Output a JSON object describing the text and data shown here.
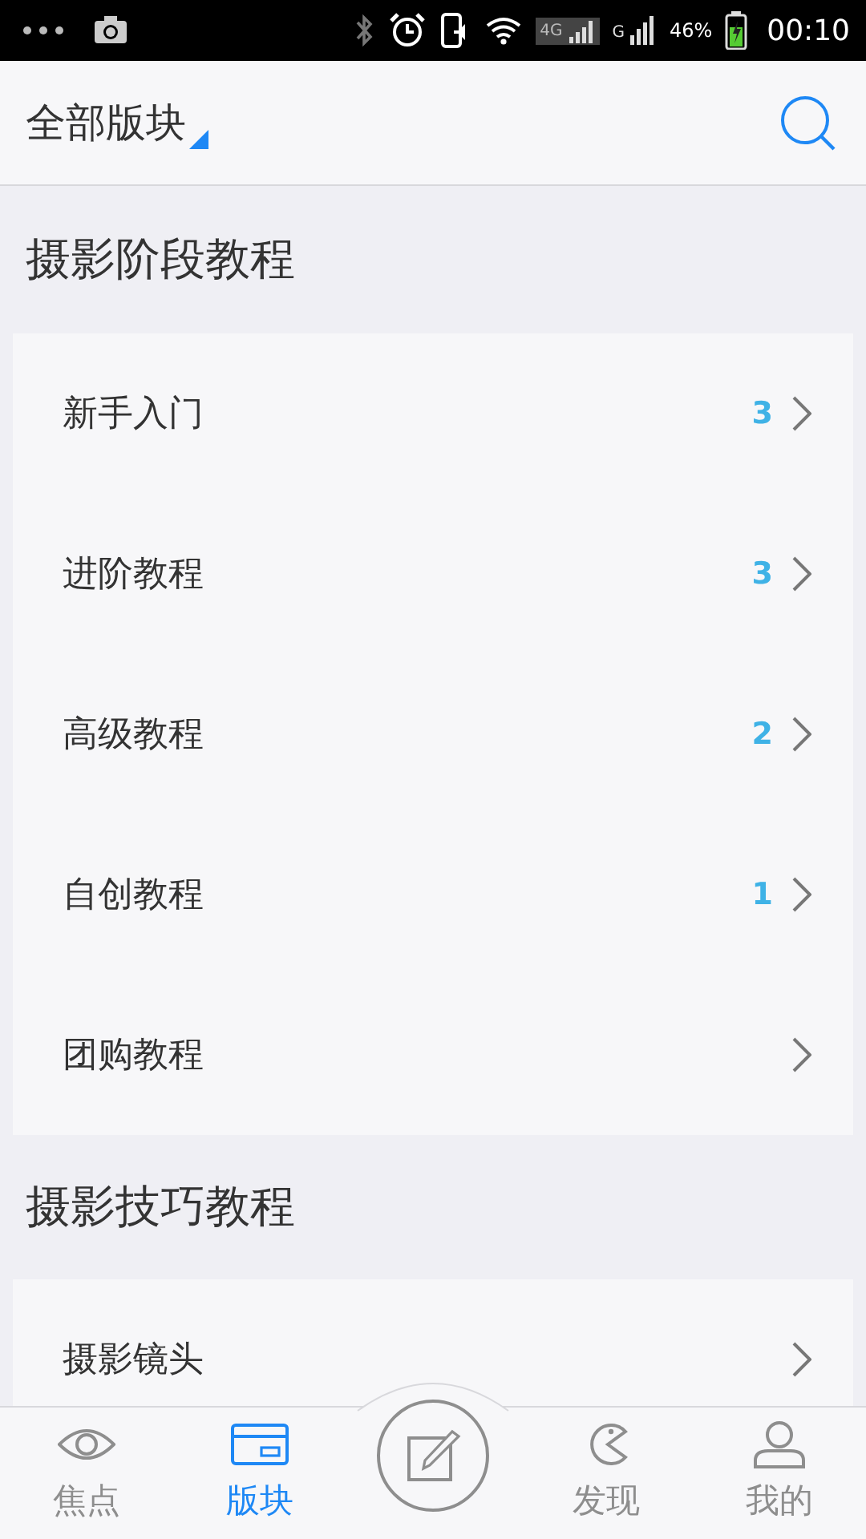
{
  "status_bar": {
    "network_1": "4G",
    "network_2": "G",
    "battery": "46%",
    "time": "00:10"
  },
  "header": {
    "title": "全部版块"
  },
  "sections": [
    {
      "title": "摄影阶段教程",
      "items": [
        {
          "label": "新手入门",
          "count": "3"
        },
        {
          "label": "进阶教程",
          "count": "3"
        },
        {
          "label": "高级教程",
          "count": "2"
        },
        {
          "label": "自创教程",
          "count": "1"
        },
        {
          "label": "团购教程"
        }
      ]
    },
    {
      "title": "摄影技巧教程",
      "items": [
        {
          "label": "摄影镜头"
        }
      ]
    }
  ],
  "tab_bar": [
    {
      "kind": "eye",
      "label": "焦点",
      "selected": false
    },
    {
      "kind": "card",
      "label": "版块",
      "selected": true
    },
    {
      "kind": "compose",
      "selected": false
    },
    {
      "kind": "pacman",
      "label": "发现",
      "selected": false
    },
    {
      "kind": "person",
      "label": "我的",
      "selected": false
    }
  ]
}
